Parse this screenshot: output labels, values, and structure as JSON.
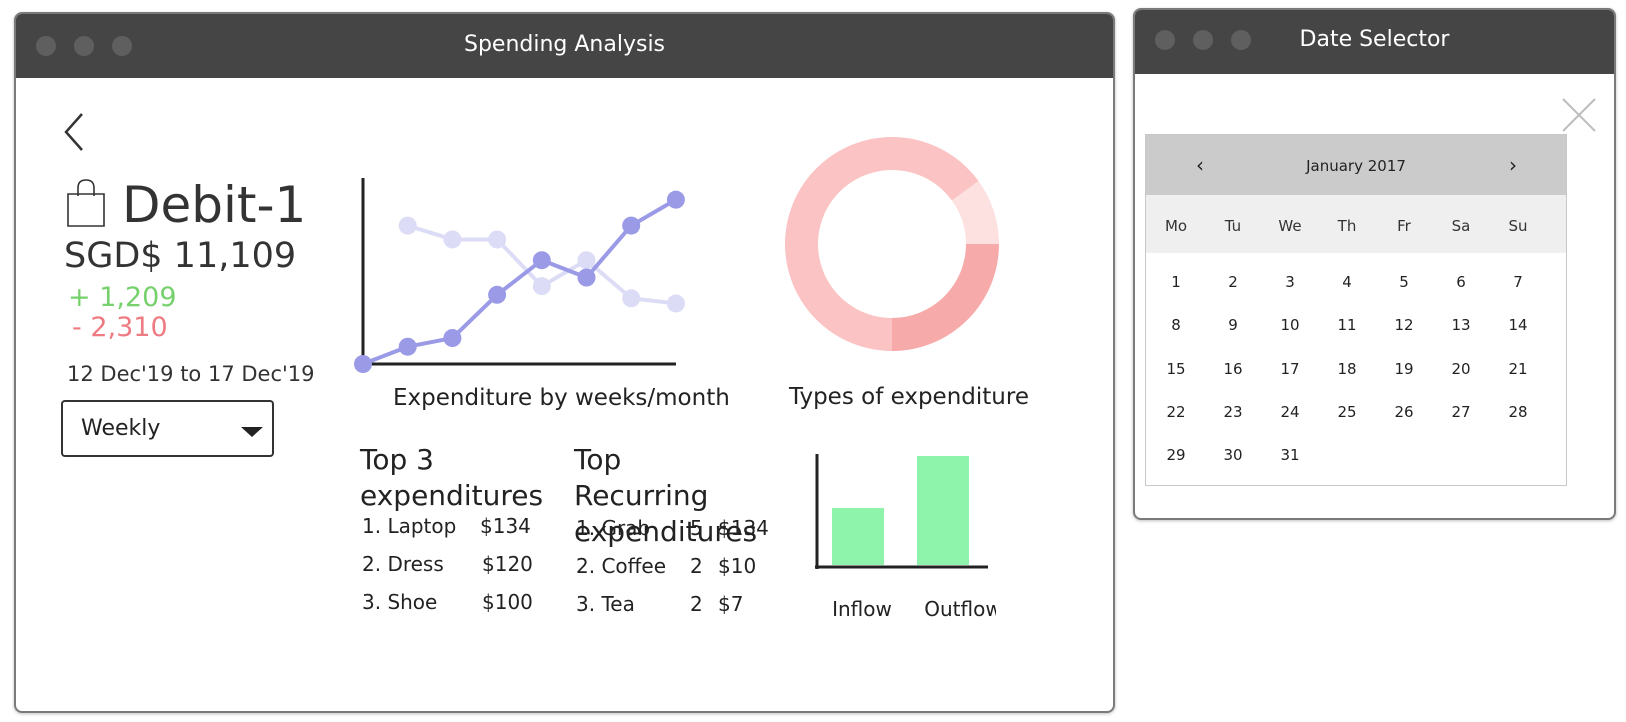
{
  "main_window": {
    "title": "Spending Analysis",
    "account": {
      "name": "Debit-1",
      "balance": "SGD$ 11,109",
      "inflow": "+ 1,209",
      "outflow": "- 2,310",
      "date_range": "12 Dec'19  to 17 Dec'19"
    },
    "period_select": {
      "value": "Weekly"
    },
    "line_chart_caption": "Expenditure by weeks/month",
    "donut_caption": "Types of expenditure",
    "top3": {
      "heading": "Top 3 expenditures",
      "items": [
        {
          "name": "1. Laptop",
          "amount": "$134"
        },
        {
          "name": "2. Dress",
          "amount": "$120"
        },
        {
          "name": "3. Shoe",
          "amount": "$100"
        }
      ]
    },
    "recurring": {
      "heading": "Top Recurring expenditures",
      "items": [
        {
          "name": "1. Grab",
          "count": "5",
          "amount": "$134"
        },
        {
          "name": "2. Coffee",
          "count": "2",
          "amount": "$10"
        },
        {
          "name": "3. Tea",
          "count": "2",
          "amount": "$7"
        }
      ]
    },
    "bar_labels": [
      "Inflow",
      "Outflow"
    ]
  },
  "colors": {
    "titlebar": "#454545",
    "positive": "#76d16c",
    "negative": "#ee7b82",
    "line_primary": "#9a9ae6",
    "line_secondary": "#dcdcf6",
    "bar": "#8ff4ab",
    "donut_segments": [
      "#f7aaaa",
      "#fbc3c3",
      "#fde0e0"
    ]
  },
  "chart_data": [
    {
      "type": "line",
      "x": [
        1,
        2,
        3,
        4,
        5,
        6,
        7,
        8
      ],
      "series": [
        {
          "values": [
            0,
            0.1,
            0.15,
            0.4,
            0.6,
            0.5,
            0.8,
            0.95
          ]
        },
        {
          "values": [
            0.8,
            0.72,
            0.72,
            0.45,
            0.6,
            0.38,
            0.35
          ]
        }
      ],
      "ylim": [
        0,
        1
      ]
    },
    {
      "type": "pie",
      "values": [
        25,
        65,
        10
      ]
    },
    {
      "type": "bar",
      "categories": [
        "Inflow",
        "Outflow"
      ],
      "values": [
        1209,
        2310
      ]
    }
  ],
  "calendar_window": {
    "title": "Date Selector",
    "month": "January 2017",
    "prev": "‹",
    "next": "›",
    "weekdays": [
      "Mo",
      "Tu",
      "We",
      "Th",
      "Fr",
      "Sa",
      "Su"
    ],
    "days": [
      "1",
      "2",
      "3",
      "4",
      "5",
      "6",
      "7",
      "8",
      "9",
      "10",
      "11",
      "12",
      "13",
      "14",
      "15",
      "16",
      "17",
      "18",
      "19",
      "20",
      "21",
      "22",
      "23",
      "24",
      "25",
      "26",
      "27",
      "28",
      "29",
      "30",
      "31"
    ]
  }
}
